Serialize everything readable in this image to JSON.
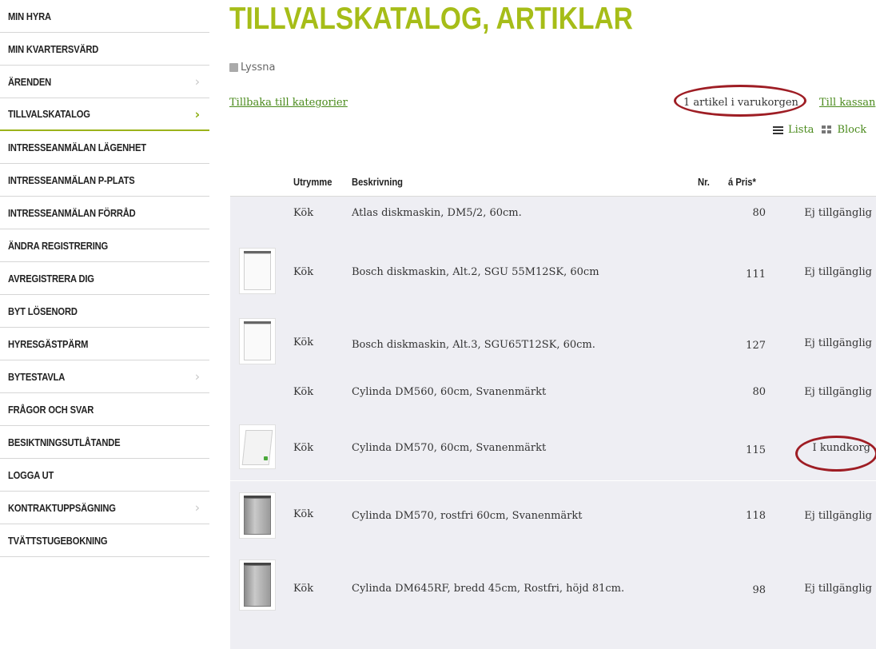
{
  "sidebar": {
    "items": [
      {
        "label": "MIN HYRA"
      },
      {
        "label": "MIN KVARTERSVÄRD"
      },
      {
        "label": "ÄRENDEN"
      },
      {
        "label": "TILLVALSKATALOG"
      },
      {
        "label": "INTRESSEANMÄLAN LÄGENHET"
      },
      {
        "label": "INTRESSEANMÄLAN P-PLATS"
      },
      {
        "label": "INTRESSEANMÄLAN FÖRRÅD"
      },
      {
        "label": "ÄNDRA REGISTRERING"
      },
      {
        "label": "AVREGISTRERA DIG"
      },
      {
        "label": "BYT LÖSENORD"
      },
      {
        "label": "HYRESGÄSTPÄRM"
      },
      {
        "label": "BYTESTAVLA"
      },
      {
        "label": "FRÅGOR OCH SVAR"
      },
      {
        "label": "BESIKTNINGSUTLÅTANDE"
      },
      {
        "label": "LOGGA UT"
      },
      {
        "label": "KONTRAKTUPPSÄGNING"
      },
      {
        "label": "TVÄTTSTUGEBOKNING"
      }
    ],
    "chevron": "›"
  },
  "page": {
    "title": "TILLVALSKATALOG, ARTIKLAR",
    "listen": "Lyssna",
    "back_link": "Tillbaka till kategorier",
    "cart_count": "1 artikel i varukorgen",
    "checkout_link": "Till kassan",
    "view_list": "Lista",
    "view_block": "Block"
  },
  "table": {
    "headers": {
      "room": "Utrymme",
      "desc": "Beskrivning",
      "nr": "Nr.",
      "price": "á Pris*"
    },
    "rows": [
      {
        "room": "Kök",
        "desc": "Atlas diskmaskin, DM5/2, 60cm.",
        "nr": "",
        "price": "80",
        "status": "Ej tillgänglig",
        "image": "none"
      },
      {
        "room": "Kök",
        "desc": "Bosch diskmaskin, Alt.2, SGU 55M12SK, 60cm",
        "nr": "",
        "price": "111",
        "status": "Ej tillgänglig",
        "image": "dishwasher-white"
      },
      {
        "room": "Kök",
        "desc": "Bosch diskmaskin, Alt.3, SGU65T12SK, 60cm.",
        "nr": "",
        "price": "127",
        "status": "Ej tillgänglig",
        "image": "dishwasher-white"
      },
      {
        "room": "Kök",
        "desc": "Cylinda DM560, 60cm, Svanenmärkt",
        "nr": "",
        "price": "80",
        "status": "Ej tillgänglig",
        "image": "none"
      },
      {
        "room": "Kök",
        "desc": "Cylinda DM570, 60cm, Svanenmärkt",
        "nr": "",
        "price": "115",
        "status": "I kundkorg",
        "image": "dishwasher-open"
      },
      {
        "room": "Kök",
        "desc": "Cylinda DM570, rostfri 60cm, Svanenmärkt",
        "nr": "",
        "price": "118",
        "status": "Ej tillgänglig",
        "image": "dishwasher-steel"
      },
      {
        "room": "Kök",
        "desc": "Cylinda DM645RF, bredd 45cm, Rostfri, höjd 81cm.",
        "nr": "",
        "price": "98",
        "status": "Ej tillgänglig",
        "image": "dishwasher-steel"
      }
    ]
  },
  "colors": {
    "accent": "#a6bd18",
    "link": "#4a8a1c",
    "highlight_oval": "#9e1d24",
    "row_bg": "#eeeef3"
  }
}
